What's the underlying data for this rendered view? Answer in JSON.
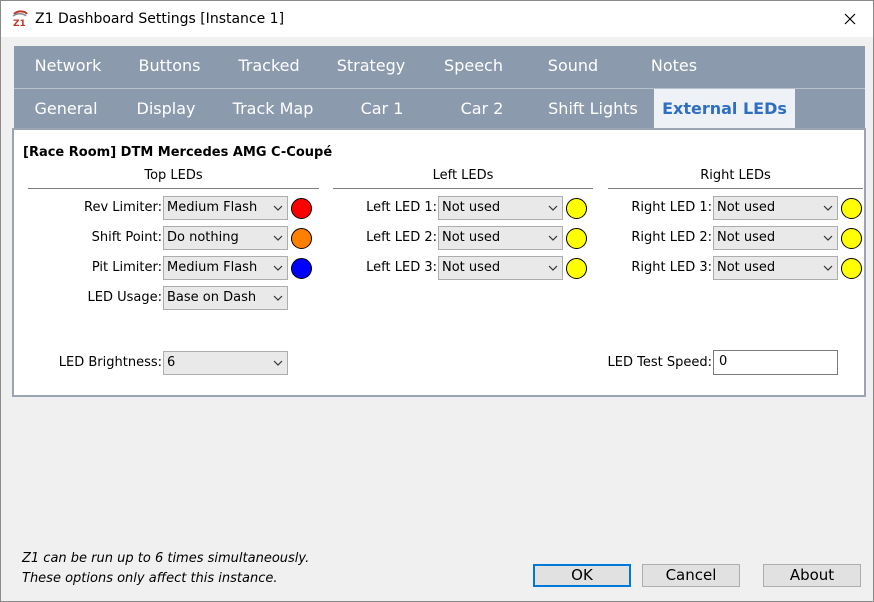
{
  "window": {
    "title": "Z1 Dashboard Settings [Instance 1]",
    "icon": "z1-app-icon",
    "close_icon": "close-icon"
  },
  "tabs_row1": [
    "Network",
    "Buttons",
    "Tracked",
    "Strategy",
    "Speech",
    "Sound",
    "Notes"
  ],
  "tabs_row2": [
    "General",
    "Display",
    "Track Map",
    "Car 1",
    "Car 2",
    "Shift Lights",
    "External LEDs"
  ],
  "active_tab": "External LEDs",
  "car_name": "[Race Room] DTM Mercedes AMG C-Coupé",
  "top_leds": {
    "heading": "Top LEDs",
    "rows": [
      {
        "label": "Rev Limiter:",
        "value": "Medium Flash",
        "led_color": "#ff0000"
      },
      {
        "label": "Shift Point:",
        "value": "Do nothing",
        "led_color": "#ff7f00"
      },
      {
        "label": "Pit Limiter:",
        "value": "Medium Flash",
        "led_color": "#0000ff"
      },
      {
        "label": "LED Usage:",
        "value": "Base on Dash"
      }
    ]
  },
  "left_leds": {
    "heading": "Left LEDs",
    "rows": [
      {
        "label": "Left LED 1:",
        "value": "Not used",
        "led_color": "#ffff00"
      },
      {
        "label": "Left LED 2:",
        "value": "Not used",
        "led_color": "#ffff00"
      },
      {
        "label": "Left LED 3:",
        "value": "Not used",
        "led_color": "#ffff00"
      }
    ]
  },
  "right_leds": {
    "heading": "Right LEDs",
    "rows": [
      {
        "label": "Right LED 1:",
        "value": "Not used",
        "led_color": "#ffff00"
      },
      {
        "label": "Right LED 2:",
        "value": "Not used",
        "led_color": "#ffff00"
      },
      {
        "label": "Right LED 3:",
        "value": "Not used",
        "led_color": "#ffff00"
      }
    ]
  },
  "brightness": {
    "label": "LED Brightness:",
    "value": "6"
  },
  "test_speed": {
    "label": "LED Test Speed:",
    "value": "0"
  },
  "footer": {
    "line1": "Z1 can be run up to 6 times simultaneously.",
    "line2": "These options only affect this instance.",
    "ok": "OK",
    "cancel": "Cancel",
    "about": "About"
  },
  "colors": {
    "tab_bar": "#8c9aad",
    "active_tab_text": "#2f6fc2",
    "default_button_border": "#0078d7"
  }
}
